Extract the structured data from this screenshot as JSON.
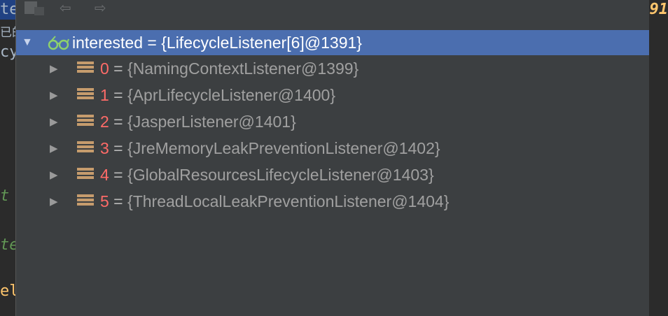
{
  "background_fragments": {
    "left_selected": "te",
    "left_cn": "已的",
    "left_cy": "cy",
    "left_t": "t",
    "left_te": "te",
    "left_el": "el",
    "right_num": "91"
  },
  "toolbar": {
    "icons": [
      "frames-icon",
      "back-arrow-icon",
      "forward-arrow-icon"
    ],
    "back_glyph": "⇦",
    "forward_glyph": "⇨"
  },
  "root": {
    "label": "interested = {LifecycleListener[6]@1391}",
    "expanded": true,
    "icon": "watch-glasses-icon"
  },
  "children": [
    {
      "index": "0",
      "eq": " = ",
      "value": "{NamingContextListener@1399}"
    },
    {
      "index": "1",
      "eq": " = ",
      "value": "{AprLifecycleListener@1400}"
    },
    {
      "index": "2",
      "eq": " = ",
      "value": "{JasperListener@1401}"
    },
    {
      "index": "3",
      "eq": " = ",
      "value": "{JreMemoryLeakPreventionListener@1402}"
    },
    {
      "index": "4",
      "eq": " = ",
      "value": "{GlobalResourcesLifecycleListener@1403}"
    },
    {
      "index": "5",
      "eq": " = ",
      "value": "{ThreadLocalLeakPreventionListener@1404}"
    }
  ],
  "colors": {
    "selection": "#4b6eaf",
    "index": "#ff6b68",
    "field_icon": "#c69c6d",
    "panel": "#3c3f41"
  }
}
